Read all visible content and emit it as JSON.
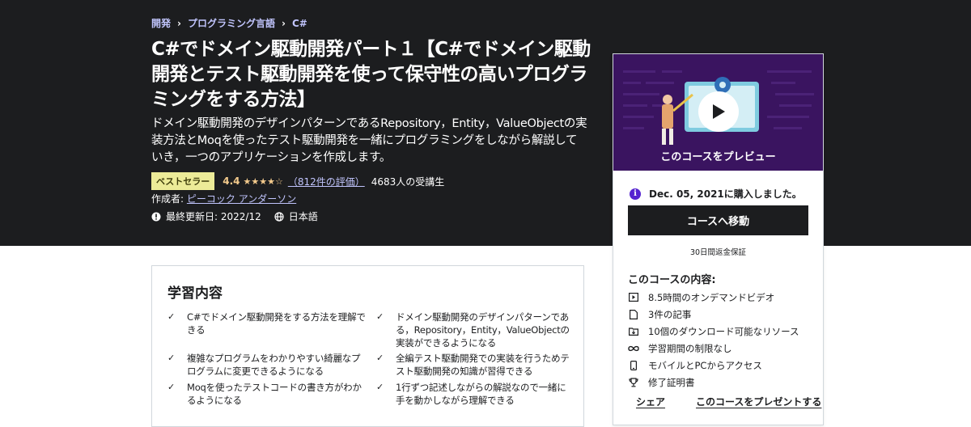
{
  "breadcrumb": {
    "items": [
      "開発",
      "プログラミング言語",
      "C#"
    ],
    "separator": "›"
  },
  "course": {
    "title": "C#でドメイン駆動開発パート１【C#でドメイン駆動開発とテスト駆動開発を使って保守性の高いプログラミングをする方法】",
    "subtitle": "ドメイン駆動開発のデザインパターンであるRepository，Entity，ValueObjectの実装方法とMoqを使ったテスト駆動開発を一緒にプログラミングをしながら解説していき，一つのアプリケーションを作成します。",
    "badge": "ベストセラー",
    "rating": "4.4",
    "stars": "★★★★☆",
    "rating_count": "（812件の評価）",
    "students": "4683人の受講生",
    "creator_label": "作成者:",
    "creator_name": "ピーコック アンダーソン",
    "last_updated": "最終更新日: 2022/12",
    "language": "日本語"
  },
  "sidebar": {
    "preview_label": "このコースをプレビュー",
    "purchased": "Dec. 05, 2021に購入しました。",
    "go_button": "コースへ移動",
    "guarantee": "30日間返金保証",
    "includes_title": "このコースの内容:",
    "includes": [
      {
        "icon": "video-icon",
        "label": "8.5時間のオンデマンドビデオ"
      },
      {
        "icon": "article-icon",
        "label": "3件の記事"
      },
      {
        "icon": "download-icon",
        "label": "10個のダウンロード可能なリソース"
      },
      {
        "icon": "infinity-icon",
        "label": "学習期間の制限なし"
      },
      {
        "icon": "mobile-icon",
        "label": "モバイルとPCからアクセス"
      },
      {
        "icon": "trophy-icon",
        "label": "修了証明書"
      }
    ],
    "share": "シェア",
    "gift": "このコースをプレゼントする"
  },
  "learn": {
    "title": "学習内容",
    "items": [
      "C#でドメイン駆動開発をする方法を理解できる",
      "ドメイン駆動開発のデザインパターンである，Repository，Entity，ValueObjectの実装ができるようになる",
      "複雑なプログラムをわかりやすい綺麗なプログラムに変更できるようになる",
      "全編テスト駆動開発での実装を行うためテスト駆動開発の知識が習得できる",
      "Moqを使ったテストコードの書き方がわかるようになる",
      "1行ずつ記述しながらの解説なので一緒に手を動かしながら理解できる"
    ],
    "check_icon": "✓"
  },
  "colors": {
    "hero_bg": "#1c1d1f",
    "link": "#c0c4fc",
    "star": "#f3ca8c",
    "badge_bg": "#eceb98",
    "accent": "#5624d0",
    "preview_bg": "#3a1460"
  }
}
